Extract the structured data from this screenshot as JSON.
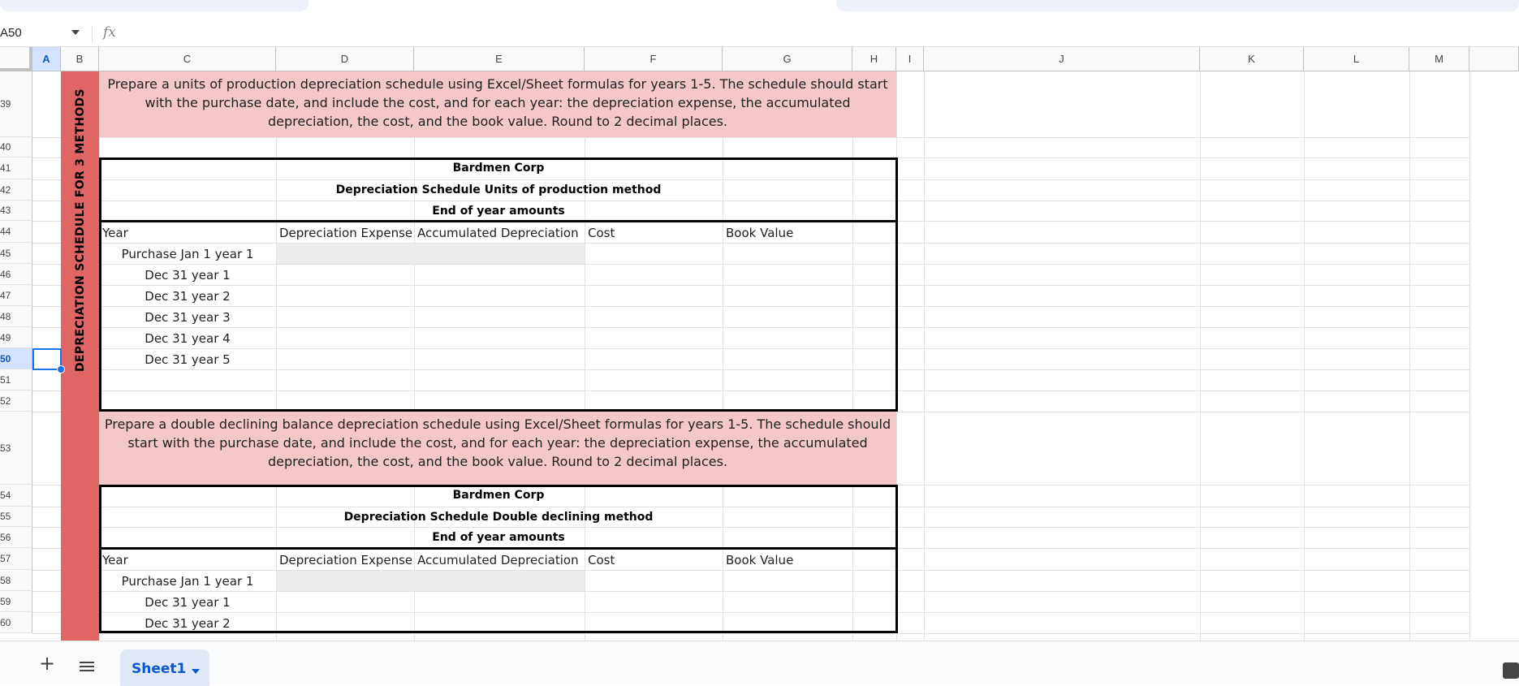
{
  "name_box": {
    "value": "A50"
  },
  "formula_bar": {
    "fx_label": "fx",
    "value": ""
  },
  "columns": [
    "A",
    "B",
    "C",
    "D",
    "E",
    "F",
    "G",
    "H",
    "I",
    "J",
    "K",
    "L",
    "M"
  ],
  "selected_column": "A",
  "rows": [
    "39",
    "40",
    "41",
    "42",
    "43",
    "44",
    "45",
    "46",
    "47",
    "48",
    "49",
    "50",
    "51",
    "52",
    "53",
    "54",
    "55",
    "56",
    "57",
    "58",
    "59",
    "60"
  ],
  "selected_row": "50",
  "vertical_title": "DEPRECIATION SCHEDULE FOR 3 METHODS",
  "section1": {
    "instruction": "Prepare a units of production depreciation schedule using Excel/Sheet formulas for years 1-5.  The schedule should start with the purchase date, and include the cost, and for each year: the depreciation expense, the accumulated depreciation, the cost, and the book value. Round to 2 decimal places.",
    "company": "Bardmen Corp",
    "title": "Depreciation Schedule Units of production method",
    "subtitle": "End of year amounts",
    "headers": [
      "Year",
      "Depreciation Expense",
      "Accumulated Depreciation",
      "Cost",
      "Book Value"
    ],
    "years": [
      "Purchase Jan 1 year 1",
      "Dec 31 year 1",
      "Dec 31 year 2",
      "Dec 31 year 3",
      "Dec 31 year 4",
      "Dec 31 year 5"
    ]
  },
  "section2": {
    "instruction": "Prepare a double declining balance depreciation schedule using Excel/Sheet formulas for years 1-5.  The schedule should start with the purchase date, and include the cost,  and for each year: the depreciation expense, the accumulated depreciation, the cost, and the book value. Round to 2 decimal places.",
    "company": "Bardmen Corp",
    "title": "Depreciation Schedule Double declining method",
    "subtitle": "End of year amounts",
    "headers": [
      "Year",
      "Depreciation Expense",
      "Accumulated Depreciation",
      "Cost",
      "Book Value"
    ],
    "years": [
      "Purchase Jan 1 year 1",
      "Dec 31 year 1",
      "Dec 31 year 2"
    ]
  },
  "sheet_tabs": [
    {
      "label": "Sheet1",
      "active": true
    }
  ],
  "colors": {
    "instruction_bg": "#f4c7c9",
    "title_bar": "#e06666",
    "selection": "#1a73e8",
    "tab_bg": "#e1e9f7",
    "tab_text": "#0b57d0"
  }
}
